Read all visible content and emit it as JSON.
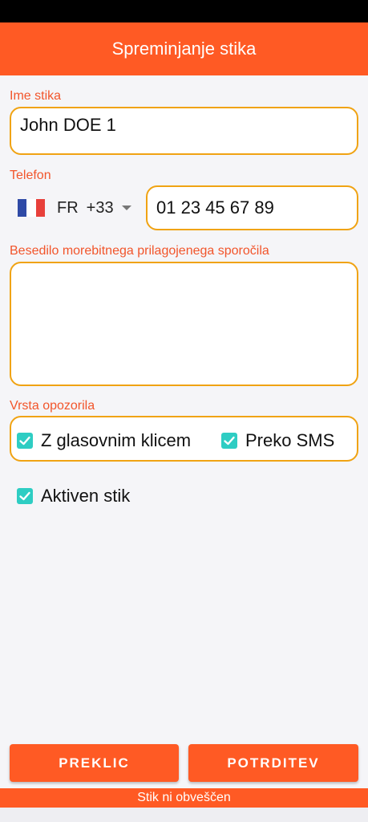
{
  "header": {
    "title": "Spreminjanje stika"
  },
  "form": {
    "name_label": "Ime stika",
    "name_value": "John DOE 1",
    "phone_label": "Telefon",
    "country_iso": "FR",
    "country_code": "+33",
    "phone_value": "01 23 45 67 89",
    "message_label": "Besedilo morebitnega prilagojenega sporočila",
    "message_value": "",
    "alert_type_label": "Vrsta opozorila",
    "voice_call_label": "Z glasovnim klicem",
    "voice_call_checked": true,
    "sms_label": "Preko SMS",
    "sms_checked": true,
    "active_label": "Aktiven stik",
    "active_checked": true
  },
  "actions": {
    "cancel_label": "PREKLIC",
    "confirm_label": "POTRDITEV"
  },
  "footer": {
    "status": "Stik ni obveščen"
  },
  "colors": {
    "accent": "#ff5a24",
    "field_border": "#f0a313",
    "label": "#f2552b",
    "checkbox": "#2ecdc3"
  },
  "icons": {
    "flag": "france-flag-icon",
    "dropdown": "triangle-down-icon",
    "check": "checkmark-icon"
  }
}
